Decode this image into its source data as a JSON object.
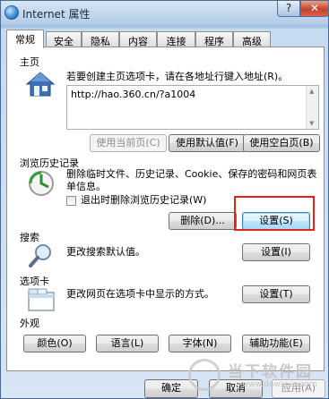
{
  "window": {
    "title": "Internet 属性",
    "help_label": "?",
    "close_label": "✕"
  },
  "tabs": [
    {
      "label": "常规",
      "active": true
    },
    {
      "label": "安全"
    },
    {
      "label": "隐私"
    },
    {
      "label": "内容"
    },
    {
      "label": "连接"
    },
    {
      "label": "程序"
    },
    {
      "label": "高级"
    }
  ],
  "home": {
    "section": "主页",
    "desc": "若要创建主页选项卡，请在各地址行键入地址(R)。",
    "url": "http://hao.360.cn/?a1004",
    "btn_current": "使用当前页(C)",
    "btn_default": "使用默认值(F)",
    "btn_blank": "使用空白页(B)"
  },
  "history": {
    "section": "浏览历史记录",
    "desc": "删除临时文件、历史记录、Cookie、保存的密码和网页表单信息。",
    "checkbox_label": "退出时删除浏览历史记录(W)",
    "btn_delete": "删除(D)...",
    "btn_settings": "设置(S)"
  },
  "search": {
    "section": "搜索",
    "desc": "更改搜索默认值。",
    "btn_settings": "设置(I)"
  },
  "tabs_section": {
    "section": "选项卡",
    "desc": "更改网页在选项卡中显示的方式。",
    "btn_settings": "设置(T)"
  },
  "appearance": {
    "section": "外观",
    "btn_colors": "颜色(O)",
    "btn_languages": "语言(L)",
    "btn_fonts": "字体(N)",
    "btn_accessibility": "辅助功能(E)"
  },
  "footer": {
    "btn_ok": "确定",
    "btn_cancel": "取消",
    "btn_apply": "应用(A)"
  },
  "watermark": {
    "text": "当下软件园",
    "url": "www.downxia.com"
  },
  "colors": {
    "highlight": "#e2231a"
  }
}
